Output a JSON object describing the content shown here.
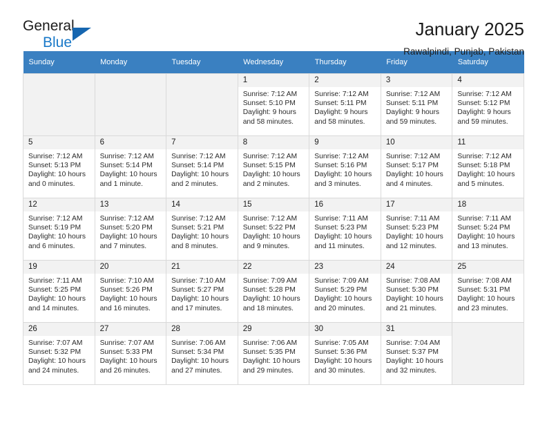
{
  "brand": {
    "name_top": "General",
    "name_bottom": "Blue",
    "triangle_color": "#1666b0",
    "blue_color": "#1878c8"
  },
  "header": {
    "title": "January 2025",
    "location": "Rawalpindi, Punjab, Pakistan"
  },
  "theme": {
    "header_row_bg": "#3a80c1",
    "daynum_bg": "#f2f2f2",
    "empty_cell_bg": "#f2f2f2",
    "border": "#d9d9d9"
  },
  "weekday_headers": [
    "Sunday",
    "Monday",
    "Tuesday",
    "Wednesday",
    "Thursday",
    "Friday",
    "Saturday"
  ],
  "weeks": [
    [
      {
        "empty": true
      },
      {
        "empty": true
      },
      {
        "empty": true
      },
      {
        "day": "1",
        "sunrise": "Sunrise: 7:12 AM",
        "sunset": "Sunset: 5:10 PM",
        "daylight": "Daylight: 9 hours and 58 minutes."
      },
      {
        "day": "2",
        "sunrise": "Sunrise: 7:12 AM",
        "sunset": "Sunset: 5:11 PM",
        "daylight": "Daylight: 9 hours and 58 minutes."
      },
      {
        "day": "3",
        "sunrise": "Sunrise: 7:12 AM",
        "sunset": "Sunset: 5:11 PM",
        "daylight": "Daylight: 9 hours and 59 minutes."
      },
      {
        "day": "4",
        "sunrise": "Sunrise: 7:12 AM",
        "sunset": "Sunset: 5:12 PM",
        "daylight": "Daylight: 9 hours and 59 minutes."
      }
    ],
    [
      {
        "day": "5",
        "sunrise": "Sunrise: 7:12 AM",
        "sunset": "Sunset: 5:13 PM",
        "daylight": "Daylight: 10 hours and 0 minutes."
      },
      {
        "day": "6",
        "sunrise": "Sunrise: 7:12 AM",
        "sunset": "Sunset: 5:14 PM",
        "daylight": "Daylight: 10 hours and 1 minute."
      },
      {
        "day": "7",
        "sunrise": "Sunrise: 7:12 AM",
        "sunset": "Sunset: 5:14 PM",
        "daylight": "Daylight: 10 hours and 2 minutes."
      },
      {
        "day": "8",
        "sunrise": "Sunrise: 7:12 AM",
        "sunset": "Sunset: 5:15 PM",
        "daylight": "Daylight: 10 hours and 2 minutes."
      },
      {
        "day": "9",
        "sunrise": "Sunrise: 7:12 AM",
        "sunset": "Sunset: 5:16 PM",
        "daylight": "Daylight: 10 hours and 3 minutes."
      },
      {
        "day": "10",
        "sunrise": "Sunrise: 7:12 AM",
        "sunset": "Sunset: 5:17 PM",
        "daylight": "Daylight: 10 hours and 4 minutes."
      },
      {
        "day": "11",
        "sunrise": "Sunrise: 7:12 AM",
        "sunset": "Sunset: 5:18 PM",
        "daylight": "Daylight: 10 hours and 5 minutes."
      }
    ],
    [
      {
        "day": "12",
        "sunrise": "Sunrise: 7:12 AM",
        "sunset": "Sunset: 5:19 PM",
        "daylight": "Daylight: 10 hours and 6 minutes."
      },
      {
        "day": "13",
        "sunrise": "Sunrise: 7:12 AM",
        "sunset": "Sunset: 5:20 PM",
        "daylight": "Daylight: 10 hours and 7 minutes."
      },
      {
        "day": "14",
        "sunrise": "Sunrise: 7:12 AM",
        "sunset": "Sunset: 5:21 PM",
        "daylight": "Daylight: 10 hours and 8 minutes."
      },
      {
        "day": "15",
        "sunrise": "Sunrise: 7:12 AM",
        "sunset": "Sunset: 5:22 PM",
        "daylight": "Daylight: 10 hours and 9 minutes."
      },
      {
        "day": "16",
        "sunrise": "Sunrise: 7:11 AM",
        "sunset": "Sunset: 5:23 PM",
        "daylight": "Daylight: 10 hours and 11 minutes."
      },
      {
        "day": "17",
        "sunrise": "Sunrise: 7:11 AM",
        "sunset": "Sunset: 5:23 PM",
        "daylight": "Daylight: 10 hours and 12 minutes."
      },
      {
        "day": "18",
        "sunrise": "Sunrise: 7:11 AM",
        "sunset": "Sunset: 5:24 PM",
        "daylight": "Daylight: 10 hours and 13 minutes."
      }
    ],
    [
      {
        "day": "19",
        "sunrise": "Sunrise: 7:11 AM",
        "sunset": "Sunset: 5:25 PM",
        "daylight": "Daylight: 10 hours and 14 minutes."
      },
      {
        "day": "20",
        "sunrise": "Sunrise: 7:10 AM",
        "sunset": "Sunset: 5:26 PM",
        "daylight": "Daylight: 10 hours and 16 minutes."
      },
      {
        "day": "21",
        "sunrise": "Sunrise: 7:10 AM",
        "sunset": "Sunset: 5:27 PM",
        "daylight": "Daylight: 10 hours and 17 minutes."
      },
      {
        "day": "22",
        "sunrise": "Sunrise: 7:09 AM",
        "sunset": "Sunset: 5:28 PM",
        "daylight": "Daylight: 10 hours and 18 minutes."
      },
      {
        "day": "23",
        "sunrise": "Sunrise: 7:09 AM",
        "sunset": "Sunset: 5:29 PM",
        "daylight": "Daylight: 10 hours and 20 minutes."
      },
      {
        "day": "24",
        "sunrise": "Sunrise: 7:08 AM",
        "sunset": "Sunset: 5:30 PM",
        "daylight": "Daylight: 10 hours and 21 minutes."
      },
      {
        "day": "25",
        "sunrise": "Sunrise: 7:08 AM",
        "sunset": "Sunset: 5:31 PM",
        "daylight": "Daylight: 10 hours and 23 minutes."
      }
    ],
    [
      {
        "day": "26",
        "sunrise": "Sunrise: 7:07 AM",
        "sunset": "Sunset: 5:32 PM",
        "daylight": "Daylight: 10 hours and 24 minutes."
      },
      {
        "day": "27",
        "sunrise": "Sunrise: 7:07 AM",
        "sunset": "Sunset: 5:33 PM",
        "daylight": "Daylight: 10 hours and 26 minutes."
      },
      {
        "day": "28",
        "sunrise": "Sunrise: 7:06 AM",
        "sunset": "Sunset: 5:34 PM",
        "daylight": "Daylight: 10 hours and 27 minutes."
      },
      {
        "day": "29",
        "sunrise": "Sunrise: 7:06 AM",
        "sunset": "Sunset: 5:35 PM",
        "daylight": "Daylight: 10 hours and 29 minutes."
      },
      {
        "day": "30",
        "sunrise": "Sunrise: 7:05 AM",
        "sunset": "Sunset: 5:36 PM",
        "daylight": "Daylight: 10 hours and 30 minutes."
      },
      {
        "day": "31",
        "sunrise": "Sunrise: 7:04 AM",
        "sunset": "Sunset: 5:37 PM",
        "daylight": "Daylight: 10 hours and 32 minutes."
      },
      {
        "empty": true
      }
    ]
  ]
}
